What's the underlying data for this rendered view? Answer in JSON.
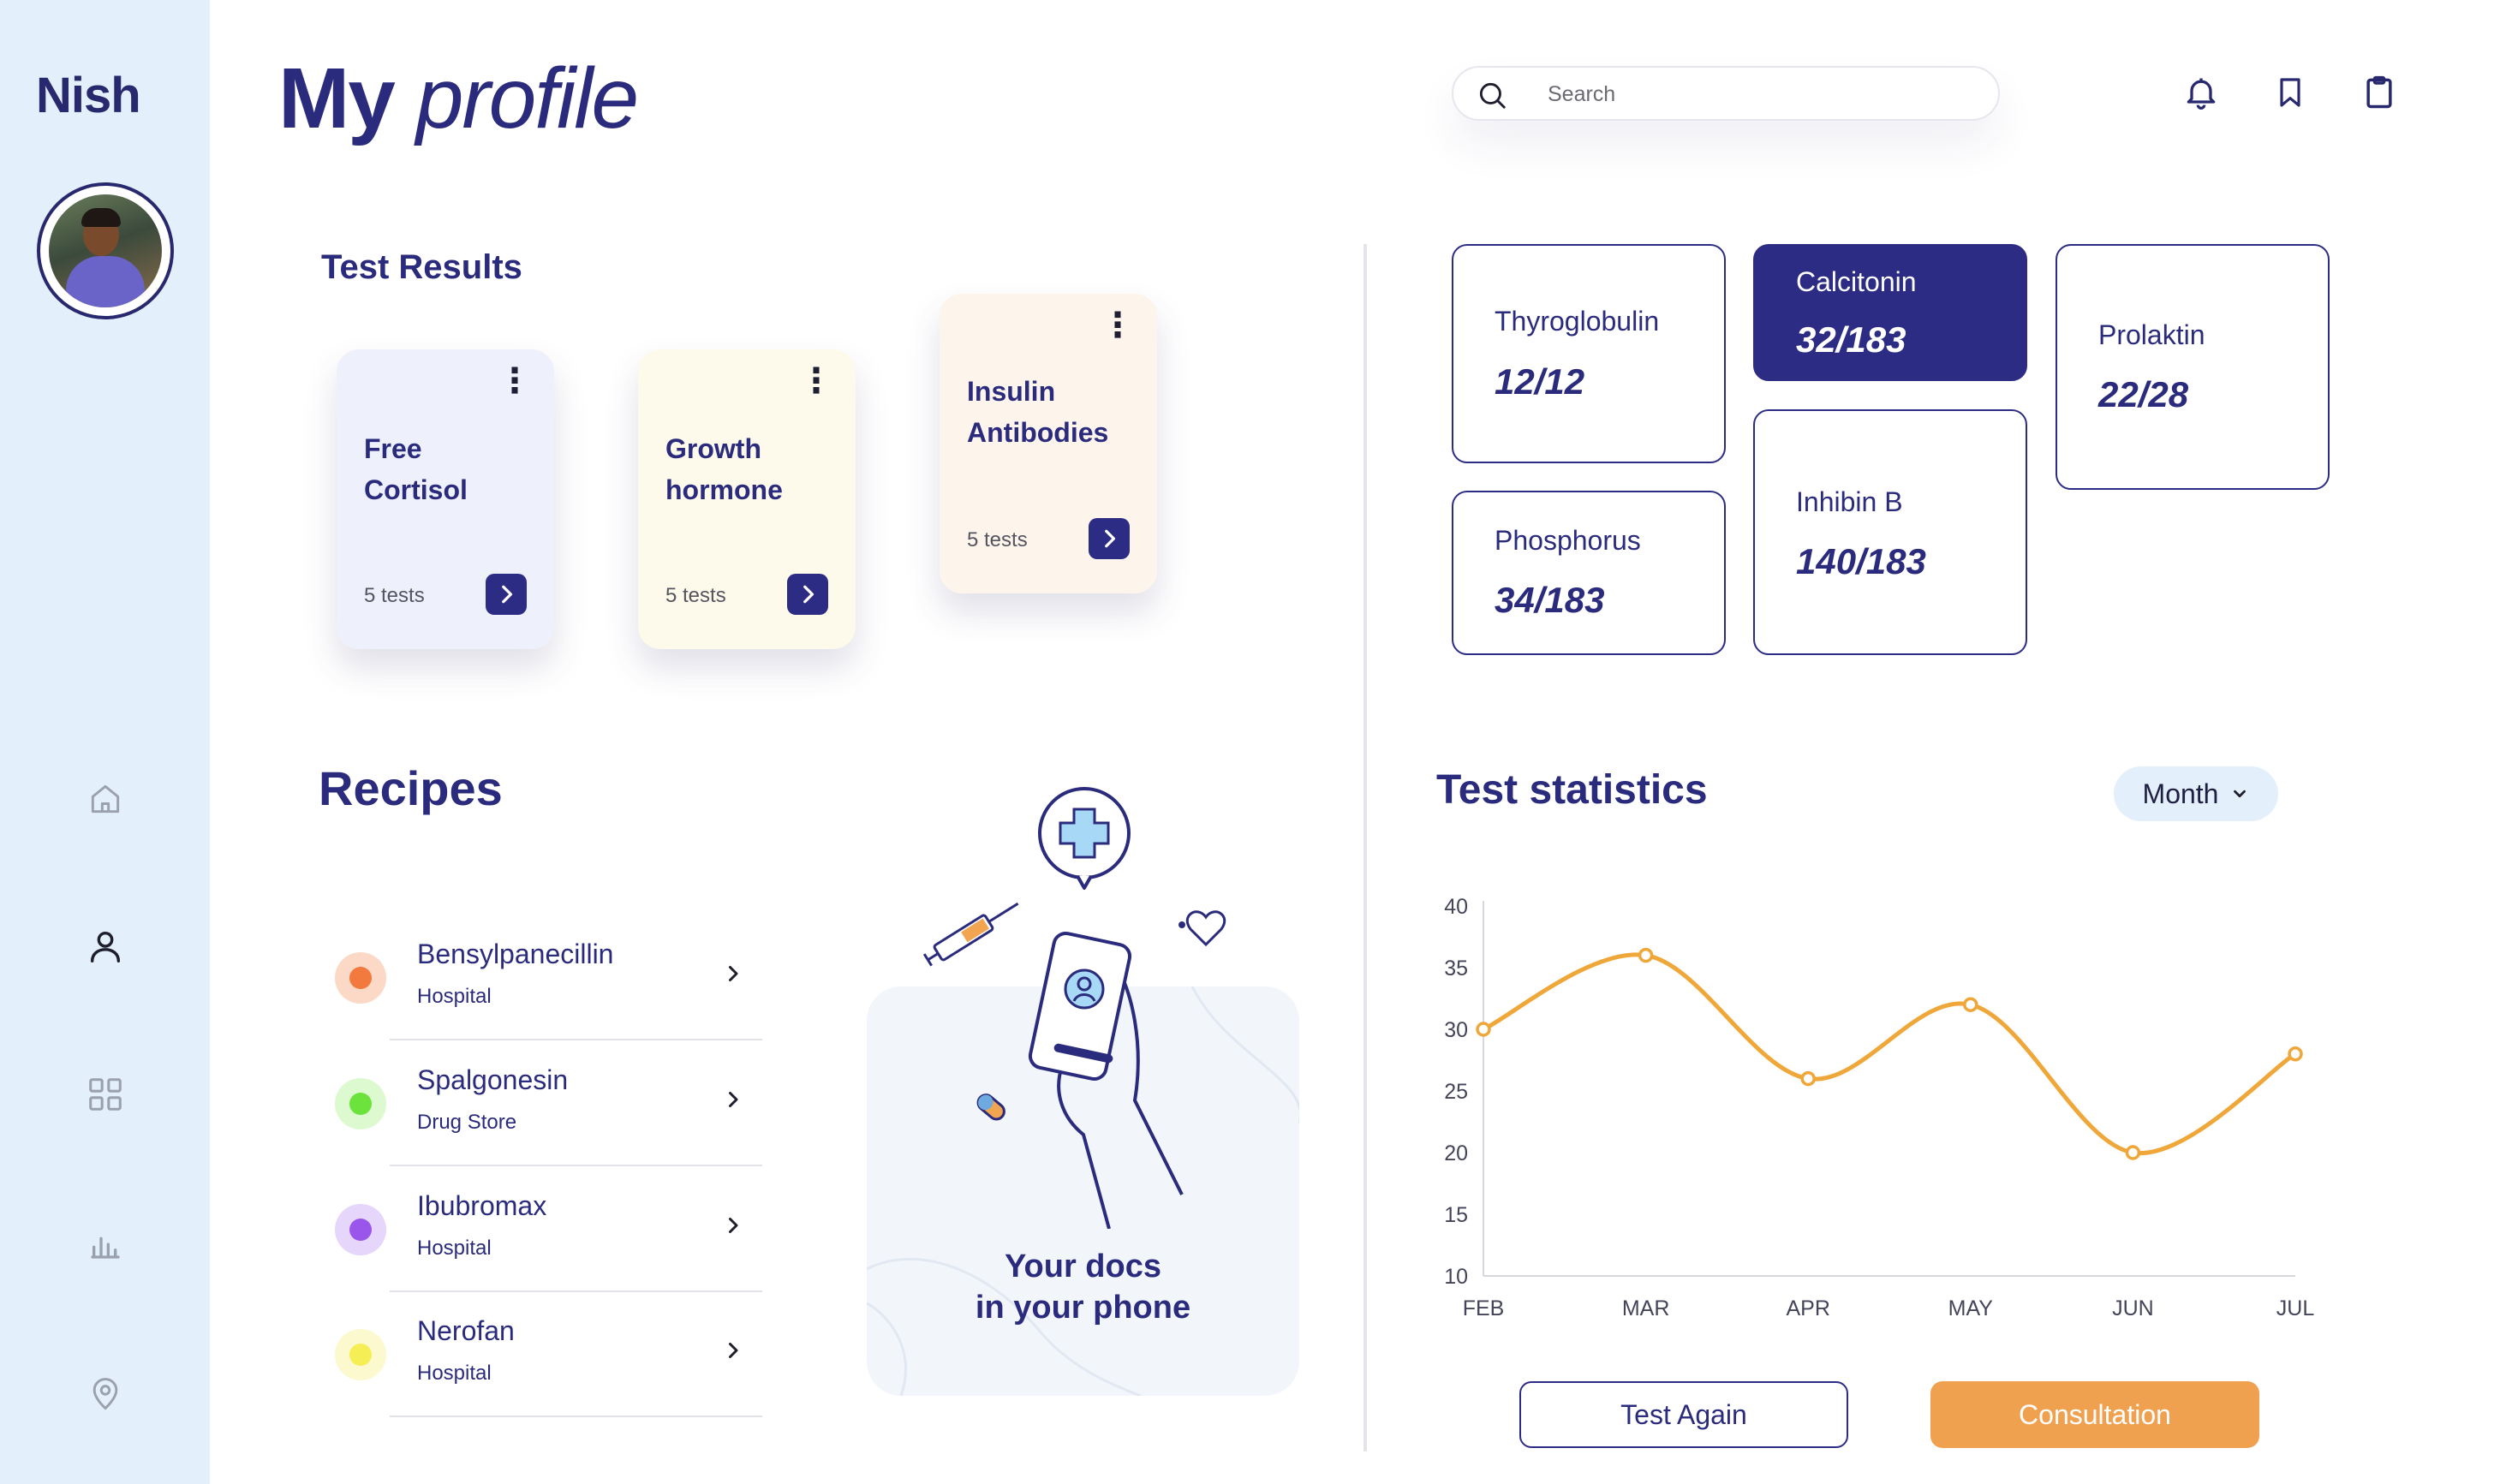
{
  "app": {
    "brand": "Nish"
  },
  "header": {
    "title_bold": "My",
    "title_italic": "profile",
    "search_placeholder": "Search"
  },
  "test_results": {
    "title": "Test Results",
    "cards": [
      {
        "name": "Free Cortisol",
        "count": "5 tests",
        "bg": "#eef0fc"
      },
      {
        "name": "Growth hormone",
        "count": "5 tests",
        "bg": "#fdfaec"
      },
      {
        "name": "Insulin Antibodies",
        "count": "5 tests",
        "bg": "#fdf5ec"
      }
    ]
  },
  "hormones": [
    {
      "name": "Thyroglobulin",
      "value": "12/12",
      "active": false
    },
    {
      "name": "Calcitonin",
      "value": "32/183",
      "active": true
    },
    {
      "name": "Prolaktin",
      "value": "22/28",
      "active": false
    },
    {
      "name": "Phosphorus",
      "value": "34/183",
      "active": false
    },
    {
      "name": "Inhibin B",
      "value": "140/183",
      "active": false
    }
  ],
  "recipes": {
    "title": "Recipes",
    "items": [
      {
        "name": "Bensylpanecillin",
        "place": "Hospital",
        "color": "#f27a3e",
        "halo": "#fbd9c6"
      },
      {
        "name": "Spalgonesin",
        "place": "Drug Store",
        "color": "#6be33c",
        "halo": "#dcf9cf"
      },
      {
        "name": "Ibubromax",
        "place": "Hospital",
        "color": "#9a55ea",
        "halo": "#e6d6fb"
      },
      {
        "name": "Nerofan",
        "place": "Hospital",
        "color": "#f5ee55",
        "halo": "#fcf9cf"
      }
    ]
  },
  "promo": {
    "line1": "Your docs",
    "line2": "in your phone"
  },
  "statistics": {
    "title": "Test statistics",
    "period": "Month"
  },
  "chart_data": {
    "type": "line",
    "title": "Test statistics",
    "x": [
      "FEB",
      "MAR",
      "APR",
      "MAY",
      "JUN",
      "JUL"
    ],
    "series": [
      {
        "values": [
          30,
          36,
          26,
          32,
          20,
          28
        ],
        "color": "#f0a73a"
      }
    ],
    "ylim": [
      10,
      40
    ],
    "yticks": [
      40,
      35,
      30,
      25,
      20,
      15,
      10
    ],
    "smooth": true,
    "grid": false
  },
  "actions": {
    "test_again": "Test Again",
    "consultation": "Consultation"
  },
  "colors": {
    "primary": "#2c2c85",
    "accent": "#f0a150",
    "sidebar": "#e3f0fb"
  }
}
